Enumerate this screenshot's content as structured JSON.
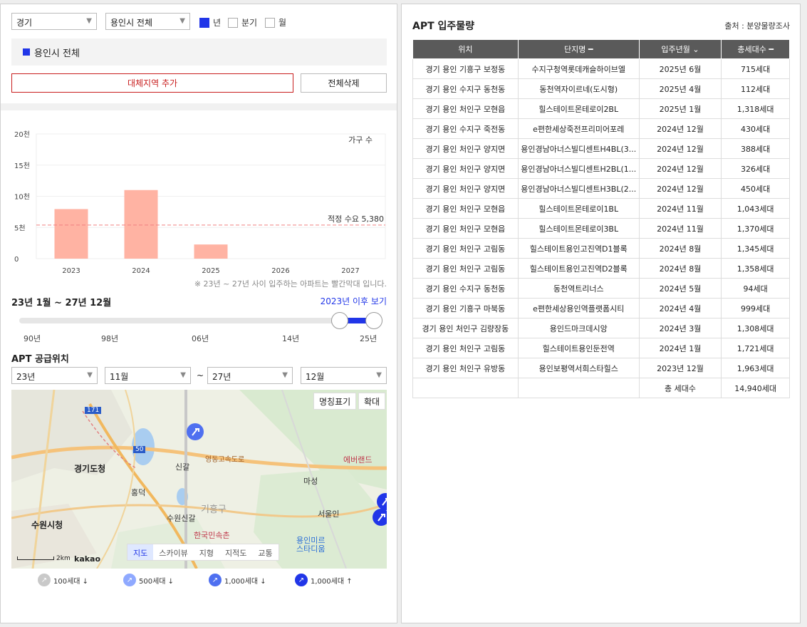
{
  "filters": {
    "province": "경기",
    "city": "용인시 전체",
    "period_options": [
      {
        "label": "년",
        "checked": true
      },
      {
        "label": "분기",
        "checked": false
      },
      {
        "label": "월",
        "checked": false
      }
    ]
  },
  "selected_region": "용인시 전체",
  "buttons": {
    "add_region": "대체지역 추가",
    "delete_all": "전체삭제"
  },
  "chart_data": {
    "type": "bar",
    "categories": [
      "2023",
      "2024",
      "2025",
      "2026",
      "2027"
    ],
    "values": [
      7950,
      11000,
      2270,
      0,
      0
    ],
    "ylim": [
      0,
      20000
    ],
    "ytick_labels": [
      "0",
      "5천",
      "10천",
      "15천",
      "20천"
    ],
    "legend_label": "가구 수",
    "reference_line": {
      "label": "적정 수요 5,380",
      "value": 5380
    },
    "bar_color": "#ffb3a3",
    "line_color": "#f08080"
  },
  "chart_note": "※ 23년 ~ 27년 사이 입주하는 아파트는 빨간막대 입니다.",
  "range": {
    "title": "23년 1월 ~ 27년 12월",
    "link": "2023년 이후 보기",
    "ticks": [
      "90년",
      "98년",
      "06년",
      "14년",
      "25년"
    ]
  },
  "supply": {
    "title": "APT 공급위치",
    "from_year": "23년",
    "from_month": "11월",
    "separator": "~",
    "to_year": "27년",
    "to_month": "12월"
  },
  "map": {
    "name_toggle": "명칭표기",
    "zoom": "확대",
    "tabs": [
      "지도",
      "스카이뷰",
      "지형",
      "지적도",
      "교통"
    ],
    "active_tab": "지도",
    "scale": "2km",
    "logo": "kakao",
    "labels": {
      "gyeonggi": "경기도청",
      "suwon": "수원시청",
      "everland": "에버랜드",
      "folk": "한국민속촌",
      "yongin_mirae": "용인미르 스타디움",
      "singal": "신갈",
      "suwon_ic": "수원신갈",
      "mabuk": "마성",
      "seoul": "서울인",
      "giheung": "기흥구",
      "highway": "영동고속도로",
      "hongdeok": "홍덕",
      "r171": "171",
      "r50": "50"
    }
  },
  "legend": [
    {
      "label": "100세대 ↓",
      "color": "#c9c9c9"
    },
    {
      "label": "500세대 ↓",
      "color": "#8fa9ff"
    },
    {
      "label": "1,000세대 ↓",
      "color": "#4f70f0"
    },
    {
      "label": "1,000세대 ↑",
      "color": "#2136e8"
    }
  ],
  "table": {
    "title": "APT 입주물량",
    "source": "출처 : 분양물량조사",
    "headers": [
      "위치",
      "단지명 ━",
      "입주년월 ⌄",
      "총세대수 ━"
    ],
    "rows": [
      [
        "경기 용인 기흥구 보정동",
        "수지구청역롯데캐슬하이브엘",
        "2025년 6월",
        "715세대"
      ],
      [
        "경기 용인 수지구 동천동",
        "동천역자이르네(도시형)",
        "2025년 4월",
        "112세대"
      ],
      [
        "경기 용인 처인구 모현읍",
        "힐스테이트몬테로이2BL",
        "2025년 1월",
        "1,318세대"
      ],
      [
        "경기 용인 수지구 죽전동",
        "e편한세상죽전프리미어포레",
        "2024년 12월",
        "430세대"
      ],
      [
        "경기 용인 처인구 양지면",
        "용인경남아너스빌디센트H4BL(3...",
        "2024년 12월",
        "388세대"
      ],
      [
        "경기 용인 처인구 양지면",
        "용인경남아너스빌디센트H2BL(1...",
        "2024년 12월",
        "326세대"
      ],
      [
        "경기 용인 처인구 양지면",
        "용인경남아너스빌디센트H3BL(2...",
        "2024년 12월",
        "450세대"
      ],
      [
        "경기 용인 처인구 모현읍",
        "힐스테이트몬테로이1BL",
        "2024년 11월",
        "1,043세대"
      ],
      [
        "경기 용인 처인구 모현읍",
        "힐스테이트몬테로이3BL",
        "2024년 11월",
        "1,370세대"
      ],
      [
        "경기 용인 처인구 고림동",
        "힐스테이트용인고진역D1블록",
        "2024년 8월",
        "1,345세대"
      ],
      [
        "경기 용인 처인구 고림동",
        "힐스테이트용인고진역D2블록",
        "2024년 8월",
        "1,358세대"
      ],
      [
        "경기 용인 수지구 동천동",
        "동천역트리너스",
        "2024년 5월",
        "94세대"
      ],
      [
        "경기 용인 기흥구 마북동",
        "e편한세상용인역플랫폼시티",
        "2024년 4월",
        "999세대"
      ],
      [
        "경기 용인 처인구 김량장동",
        "용인드마크데시앙",
        "2024년 3월",
        "1,308세대"
      ],
      [
        "경기 용인 처인구 고림동",
        "힐스테이트용인둔전역",
        "2024년 1월",
        "1,721세대"
      ],
      [
        "경기 용인 처인구 유방동",
        "용인보평역서희스타힐스",
        "2023년 12월",
        "1,963세대"
      ]
    ],
    "total_label": "총 세대수",
    "total_value": "14,940세대"
  }
}
